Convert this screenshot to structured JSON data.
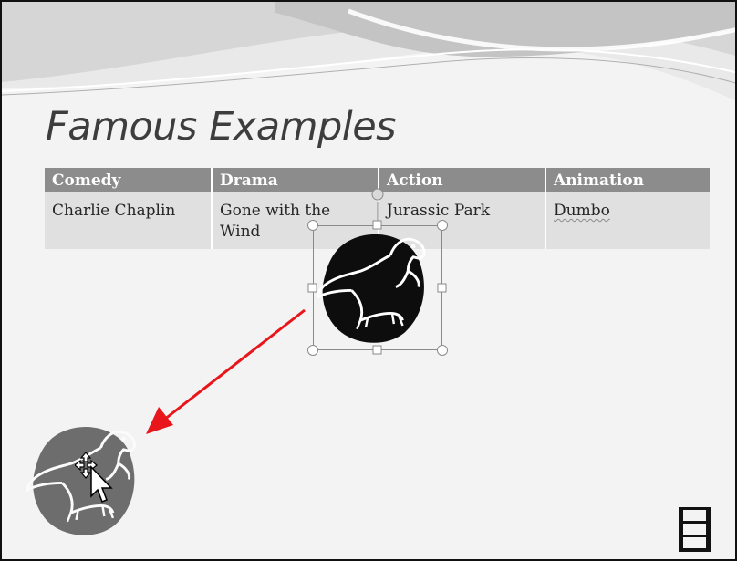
{
  "slide": {
    "title": "Famous Examples"
  },
  "table": {
    "headers": [
      "Comedy",
      "Drama",
      "Action",
      "Animation"
    ],
    "rows": [
      [
        "Charlie Chaplin",
        "Gone with the Wind",
        "Jurassic Park",
        "Dumbo"
      ]
    ]
  },
  "icons": {
    "clipart": "dinosaur-icon",
    "arrow": "red-arrow-icon",
    "cursor": "move-cursor-icon",
    "media": "film-strip-icon"
  },
  "colors": {
    "header_bg": "#8c8c8c",
    "cell_bg": "#e0e0e0",
    "arrow": "#e8161b",
    "title": "#3d3d3d"
  }
}
